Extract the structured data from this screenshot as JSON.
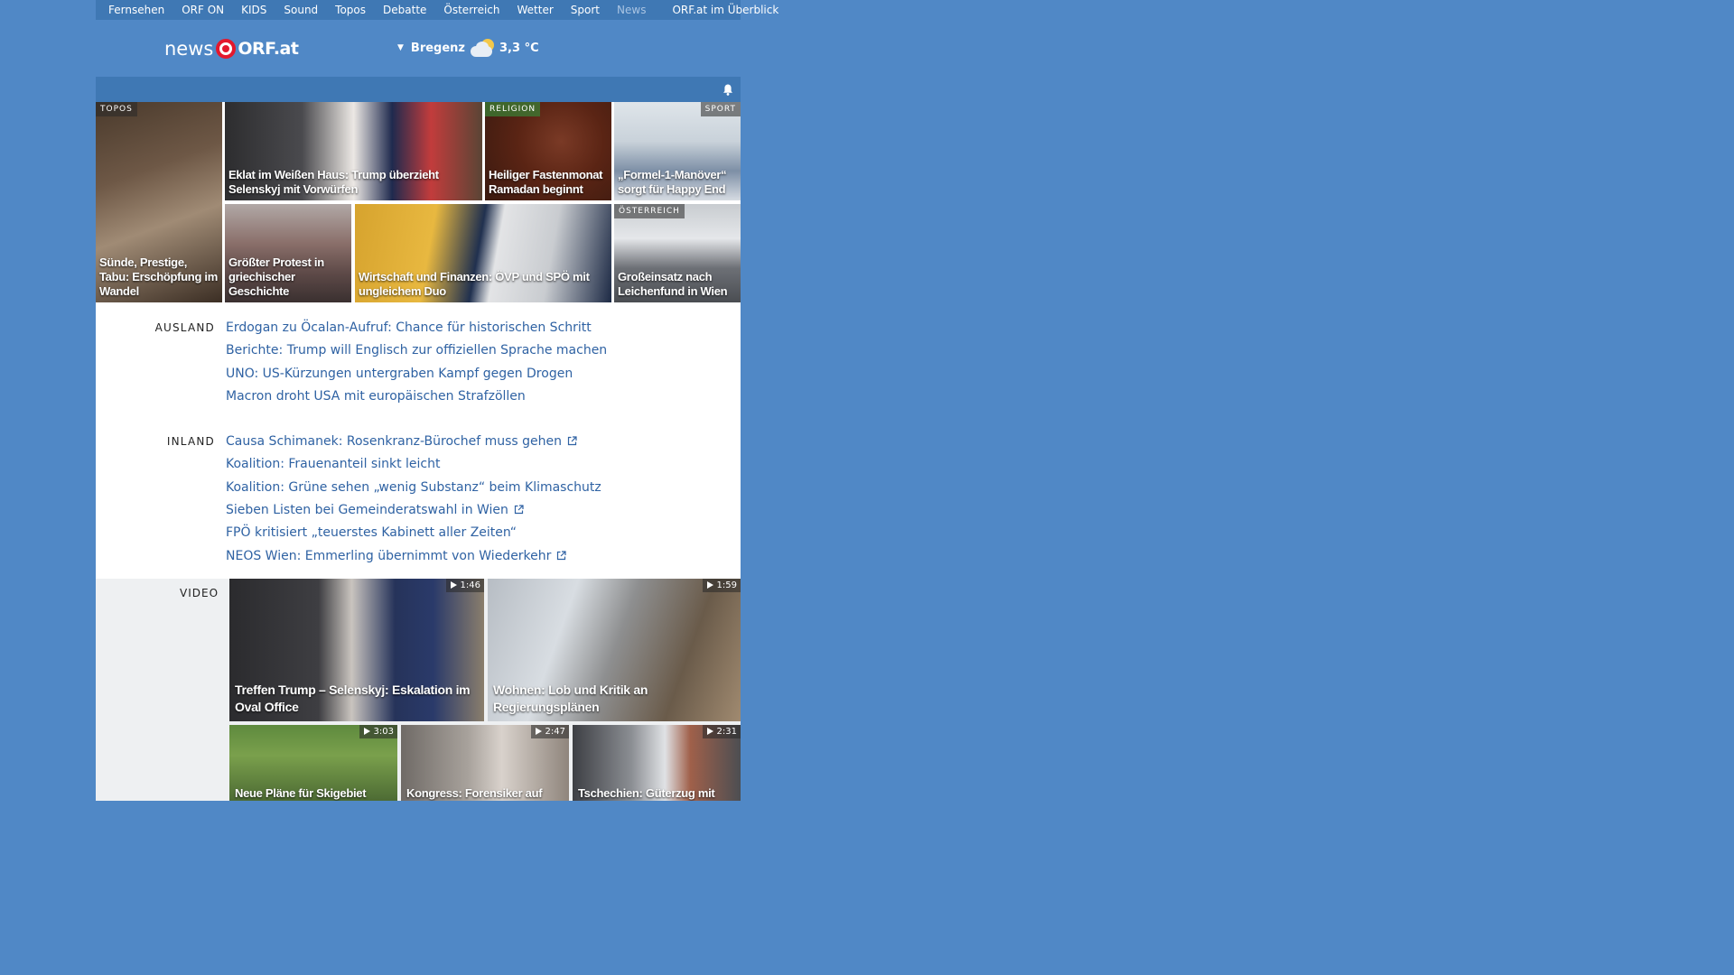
{
  "nav": {
    "items": [
      {
        "label": "Fernsehen"
      },
      {
        "label": "ORF ON"
      },
      {
        "label": "KIDS"
      },
      {
        "label": "Sound"
      },
      {
        "label": "Topos"
      },
      {
        "label": "Debatte"
      },
      {
        "label": "Österreich"
      },
      {
        "label": "Wetter"
      },
      {
        "label": "Sport"
      },
      {
        "label": "News"
      }
    ],
    "overview_label": "ORF.at im Überblick"
  },
  "header": {
    "logo_news": "news",
    "logo_orf": "ORF.at",
    "weather_location": "Bregenz",
    "weather_temp": "3,3 °C",
    "weather_icon": "sun-behind-cloud-icon"
  },
  "teasers": [
    {
      "tag": "TOPOS",
      "caption": "Sünde, Prestige, Tabu: Erschöpfung im Wandel"
    },
    {
      "tag": "",
      "caption": "Eklat im Weißen Haus: Trump überzieht Selenskyj mit Vorwürfen"
    },
    {
      "tag": "RELIGION",
      "caption": "Heiliger Fastenmonat Ramadan beginnt"
    },
    {
      "tag": "SPORT",
      "caption": "„Formel-1-Manöver“ sorgt für Happy End"
    },
    {
      "tag": "",
      "caption": "Größter Protest in griechischer Geschichte"
    },
    {
      "tag": "",
      "caption": "Wirtschaft und Finanzen: ÖVP und SPÖ mit ungleichem Duo"
    },
    {
      "tag": "ÖSTERREICH",
      "caption": "Großeinsatz nach Leichenfund in Wien"
    }
  ],
  "sections": {
    "ausland": {
      "label": "AUSLAND",
      "items": [
        {
          "text": "Erdogan zu Öcalan-Aufruf: Chance für historischen Schritt"
        },
        {
          "text": "Berichte: Trump will Englisch zur offiziellen Sprache machen"
        },
        {
          "text": "UNO: US-Kürzungen untergraben Kampf gegen Drogen"
        },
        {
          "text": "Macron droht USA mit europäischen Strafzöllen"
        }
      ]
    },
    "inland": {
      "label": "INLAND",
      "items": [
        {
          "text": "Causa Schimanek: Rosenkranz-Bürochef muss gehen",
          "external": true
        },
        {
          "text": "Koalition: Frauenanteil sinkt leicht",
          "external": false
        },
        {
          "text": "Koalition: Grüne sehen „wenig Substanz“ beim Klimaschutz",
          "external": false
        },
        {
          "text": "Sieben Listen bei Gemeinderatswahl in Wien",
          "external": true
        },
        {
          "text": "FPÖ kritisiert „teuerstes Kabinett aller Zeiten“",
          "external": false
        },
        {
          "text": "NEOS Wien: Emmerling übernimmt von Wiederkehr",
          "external": true
        }
      ]
    }
  },
  "video": {
    "label": "VIDEO",
    "items": [
      {
        "duration": "1:46",
        "caption": "Treffen Trump – Selenskyj: Eskalation im Oval Office"
      },
      {
        "duration": "1:59",
        "caption": "Wohnen: Lob und Kritik an Regierungsplänen"
      },
      {
        "duration": "3:03",
        "caption": "Neue Pläne für Skigebiet"
      },
      {
        "duration": "2:47",
        "caption": "Kongress: Forensiker auf"
      },
      {
        "duration": "2:31",
        "caption": "Tschechien: Güterzug mit"
      }
    ]
  },
  "colors": {
    "background": "#5088c6",
    "nav_bar": "#3f78b4",
    "link": "#2f62a3",
    "orf_red": "#e4182d"
  }
}
